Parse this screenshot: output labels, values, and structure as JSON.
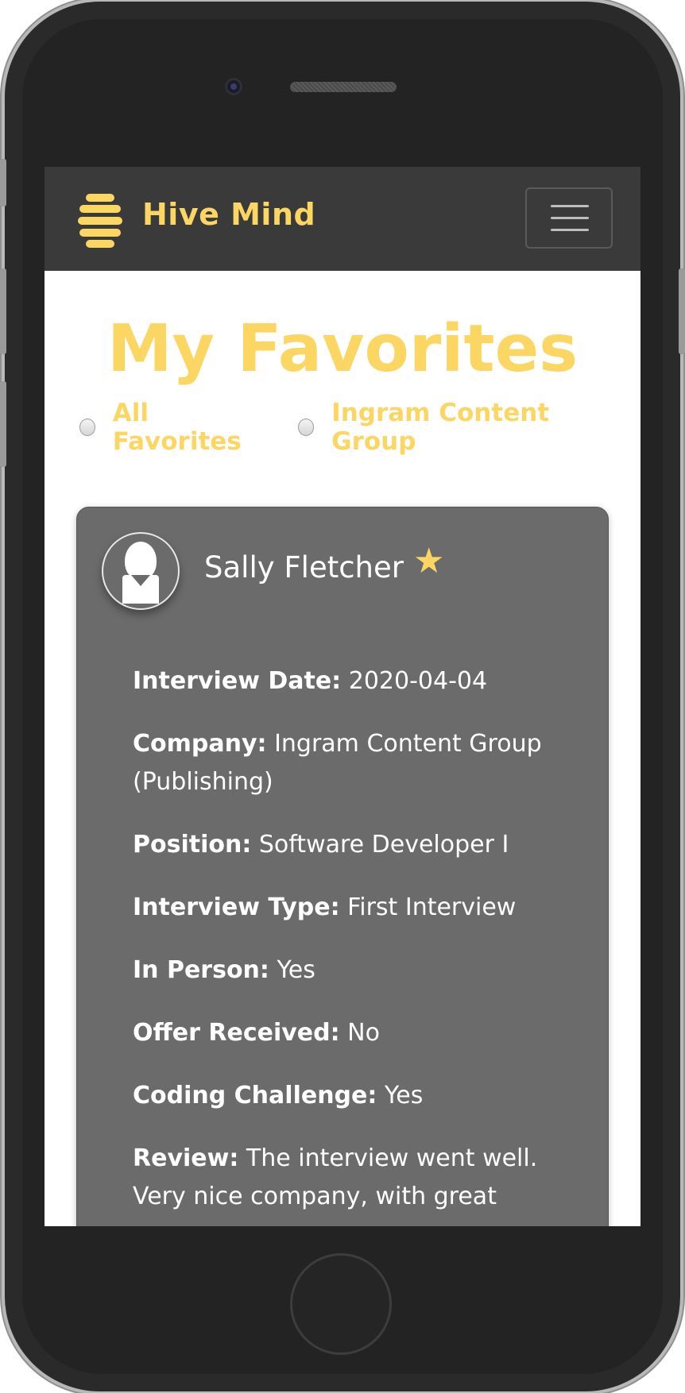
{
  "app": {
    "brand": "Hive Mind",
    "accent_color": "#fcd663"
  },
  "navbar": {
    "logo_icon": "hive-icon",
    "menu_icon": "hamburger-icon"
  },
  "page": {
    "title": "My Favorites"
  },
  "filters": [
    {
      "label": "All Favorites",
      "checked": false
    },
    {
      "label": "Ingram Content Group",
      "checked": false
    }
  ],
  "card": {
    "name": "Sally Fletcher",
    "favorite_icon": "star-icon",
    "details": [
      {
        "label": "Interview Date:",
        "value": "2020-04-04"
      },
      {
        "label": "Company:",
        "value": "Ingram Content Group (Publishing)"
      },
      {
        "label": "Position:",
        "value": "Software Developer I"
      },
      {
        "label": "Interview Type:",
        "value": "First Interview"
      },
      {
        "label": "In Person:",
        "value": "Yes"
      },
      {
        "label": "Offer Received:",
        "value": "No"
      },
      {
        "label": "Coding Challenge:",
        "value": "Yes"
      },
      {
        "label": "Review:",
        "value": "The interview went well. Very nice company, with great"
      }
    ]
  }
}
